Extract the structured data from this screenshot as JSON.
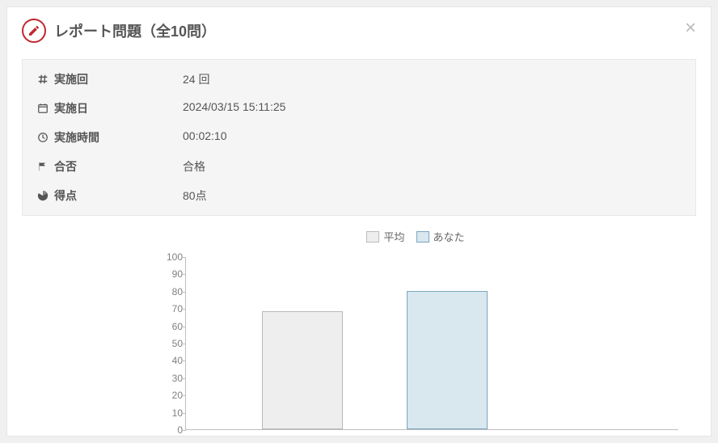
{
  "header": {
    "title": "レポート問題（全10問）"
  },
  "info": {
    "attempt_label": "実施回",
    "attempt_value": "24 回",
    "date_label": "実施日",
    "date_value": "2024/03/15 15:11:25",
    "duration_label": "実施時間",
    "duration_value": "00:02:10",
    "result_label": "合否",
    "result_value": "合格",
    "score_label": "得点",
    "score_value": "80点"
  },
  "legend": {
    "avg": "平均",
    "you": "あなた"
  },
  "chart_data": {
    "type": "bar",
    "categories": [
      "平均",
      "あなた"
    ],
    "values": [
      68,
      80
    ],
    "ylim": [
      0,
      100
    ],
    "yticks": [
      0,
      10,
      20,
      30,
      40,
      50,
      60,
      70,
      80,
      90,
      100
    ],
    "title": "",
    "xlabel": "",
    "ylabel": ""
  }
}
